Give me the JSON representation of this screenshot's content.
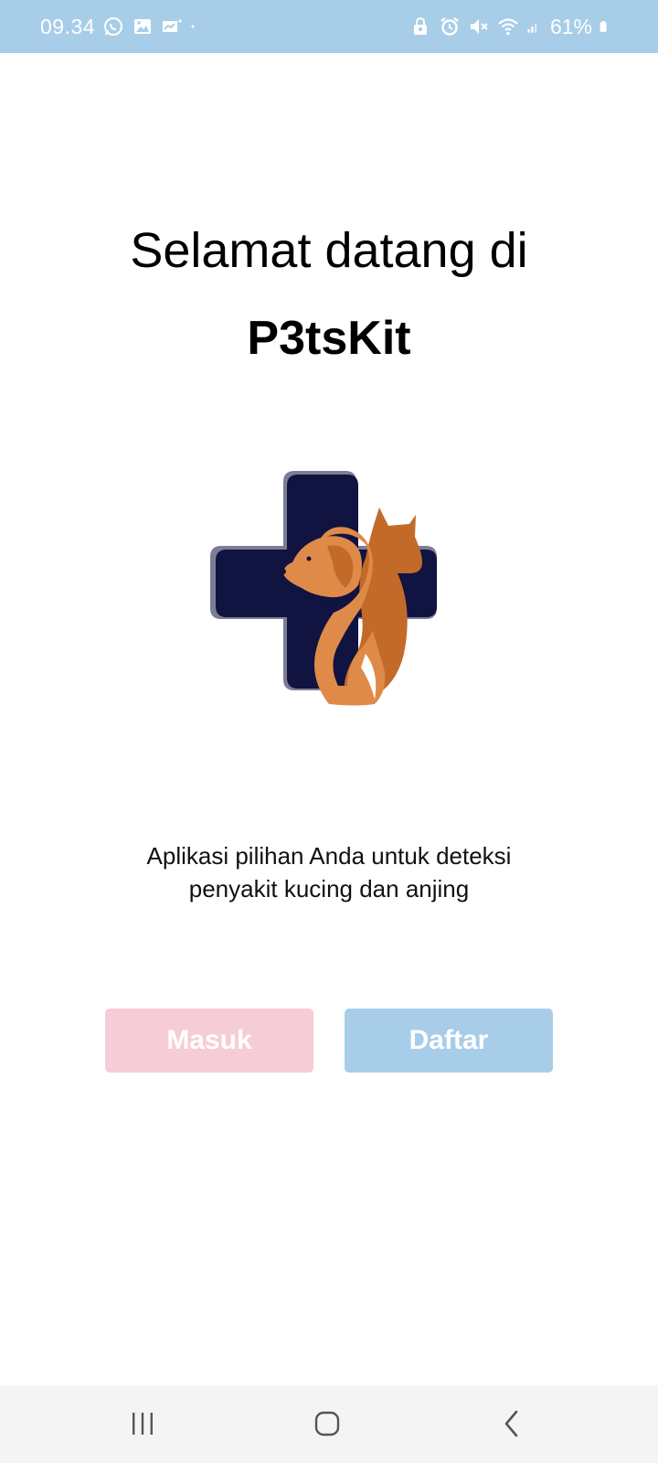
{
  "status_bar": {
    "time": "09.34",
    "battery": "61%",
    "left_icons": [
      "whatsapp-icon",
      "gallery-icon",
      "app-notification-icon",
      "dot-icon"
    ],
    "right_icons": [
      "lock-icon",
      "alarm-icon",
      "mute-icon",
      "wifi-icon",
      "signal-icon",
      "battery-icon"
    ],
    "background": "#a8cde8"
  },
  "welcome": {
    "line1": "Selamat datang di",
    "app_name": "P3tsKit"
  },
  "logo": {
    "icon": "pet-care-cross-logo",
    "colors": {
      "cross": "#111340",
      "dog": "#e08a4a",
      "cat": "#c36a2a"
    }
  },
  "tagline": {
    "line1": "Aplikasi pilihan Anda untuk deteksi",
    "line2": "penyakit kucing dan anjing"
  },
  "buttons": {
    "login_label": "Masuk",
    "register_label": "Daftar",
    "login_color": "#f6ccd6",
    "register_color": "#a8cde8"
  },
  "nav_bar": {
    "items": [
      "recent-apps-icon",
      "home-icon",
      "back-icon"
    ]
  }
}
